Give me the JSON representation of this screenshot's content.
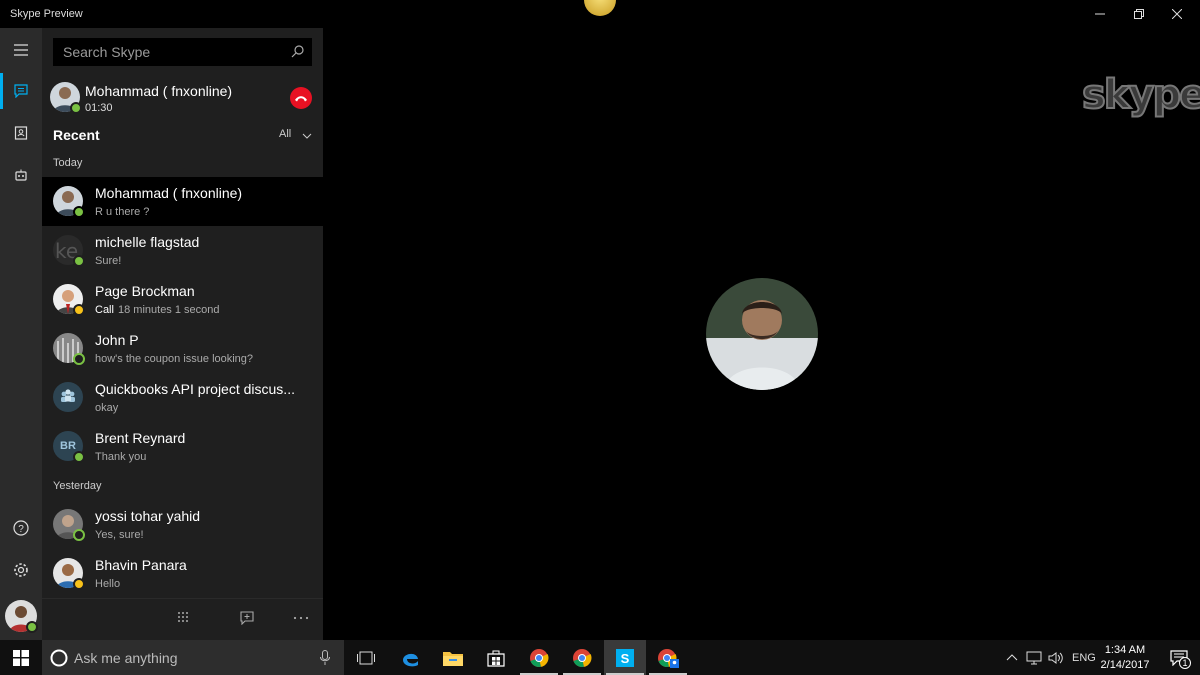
{
  "window": {
    "title": "Skype Preview"
  },
  "search": {
    "placeholder": "Search Skype"
  },
  "active_call": {
    "name": "Mohammad ( fnxonline)",
    "duration": "01:30"
  },
  "recent": {
    "heading": "Recent",
    "filter": "All"
  },
  "sections": {
    "today": "Today",
    "yesterday": "Yesterday"
  },
  "conversations_today": [
    {
      "name": "Mohammad ( fnxonline)",
      "preview": "R u there ?",
      "status": "online"
    },
    {
      "name": "michelle flagstad",
      "preview": "Sure!",
      "status": "online"
    },
    {
      "name": "Page Brockman",
      "preview_bold": "Call",
      "preview": "18 minutes 1 second",
      "status": "away"
    },
    {
      "name": "John P",
      "preview": "how's the coupon issue looking?",
      "status": "offline"
    },
    {
      "name": "Quickbooks API project discus...",
      "preview": "okay",
      "status": "group"
    },
    {
      "name": "Brent Reynard",
      "initials": "BR",
      "preview": "Thank you",
      "status": "online"
    }
  ],
  "conversations_yesterday": [
    {
      "name": "yossi tohar yahid",
      "preview": "Yes, sure!",
      "status": "offline"
    },
    {
      "name": "Bhavin Panara",
      "preview": "Hello",
      "status": "away"
    }
  ],
  "main": {
    "logo_text": "skype"
  },
  "taskbar": {
    "cortana_placeholder": "Ask me anything",
    "language": "ENG",
    "time": "1:34 AM",
    "date": "2/14/2017",
    "notification_count": "1"
  },
  "colors": {
    "accent": "#00aff0",
    "hangup": "#e81123",
    "online": "#7ac143",
    "away": "#f8c21a"
  }
}
